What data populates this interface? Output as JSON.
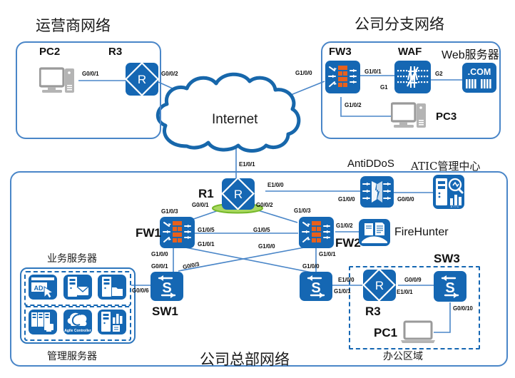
{
  "diagram": {
    "title_carrier": "运营商网络",
    "title_branch": "公司分支网络",
    "title_hq": "公司总部网络",
    "title_business_servers": "业务服务器",
    "title_mgmt_servers": "管理服务器",
    "title_office_area": "办公区域",
    "title_antiddos": "AntiDDoS",
    "title_atic": "ATIC管理中心",
    "cloud_label": "Internet"
  },
  "colors": {
    "device_blue": "#1567b3",
    "line_blue": "#4a86c8",
    "zone_border": "#4a86c8",
    "dashed_blue": "#1567b3",
    "brick_orange": "#e8601c",
    "green_ellipse": "#8cc63f",
    "pc_gray": "#9a9a9a"
  },
  "devices": {
    "pc2": "PC2",
    "r3_carrier": "R3",
    "fw3": "FW3",
    "waf": "WAF",
    "web_server": "Web服务器",
    "web_server_badge": ".COM",
    "pc3": "PC3",
    "r1": "R1",
    "fw1": "FW1",
    "fw2": "FW2",
    "sw1": "SW1",
    "sw2": "",
    "sw3": "SW3",
    "r3_office": "R3",
    "pc1": "PC1",
    "firehunter": "FireHunter",
    "antiddos": "AntiDDoS",
    "atic": "ATIC管理中心",
    "atic_badge": "ATIC"
  },
  "server_icons": {
    "ad": "AD",
    "agile": "Agile Controller"
  },
  "ports": {
    "pc2_r3": "G0/0/1",
    "r3_cloud": "G0/0/2",
    "fw3_cloud": "G1/0/0",
    "fw3_waf": "G1/0/1",
    "waf_g1": "G1",
    "waf_g2": "G2",
    "fw3_pc3": "G1/0/2",
    "r1_cloud": "E1/0/1",
    "r1_antiddos": "E1/0/0",
    "antiddos_in": "G1/0/0",
    "antiddos_out": "G0/0/0",
    "r1_fw1": "G0/0/1",
    "r1_fw2": "G0/0/2",
    "fw1_up": "G1/0/3",
    "fw2_up": "G1/0/3",
    "fw1_fw2_left": "G1/0/5",
    "fw1_fw2_right": "G1/0/5",
    "fw1_cross": "G1/0/1",
    "fw2_cross": "G1/0/0",
    "fw1_sw1": "G1/0/0",
    "fw2_sw2": "G1/0/1",
    "fw2_firehunter": "G1/0/2",
    "sw1_up1": "G0/0/1",
    "sw1_up2": "G0/0/3",
    "sw2_up": "G1/0/0",
    "sw1_servers": "G0/0/6",
    "sw2_r3": "G1/0/1",
    "r3o_sw2": "E1/0/0",
    "r3o_sw3": "E1/0/1",
    "sw3_r3": "G0/0/9",
    "sw3_pc1": "G0/0/10"
  }
}
